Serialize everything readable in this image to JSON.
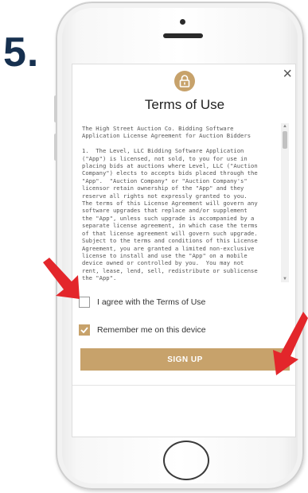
{
  "step_label": "5.",
  "modal": {
    "title": "Terms of Use",
    "close_glyph": "×",
    "lock_icon": "lock-icon",
    "terms_text": "The High Street Auction Co. Bidding Software\nApplication License Agreement for Auction Bidders\n\n1.  The Level, LLC Bidding Software Application\n(\"App\") is licensed, not sold, to you for use in\nplacing bids at auctions where Level, LLC (\"Auction\nCompany\") elects to accepts bids placed through the\n\"App\".  \"Auction Company\" or \"Auction Company's\"\nlicensor retain ownership of the \"App\" and they\nreserve all rights not expressly granted to you.\nThe terms of this License Agreement will govern any\nsoftware upgrades that replace and/or supplement\nthe \"App\", unless such upgrade is accompanied by a\nseparate license agreement, in which case the terms\nof that license agreement will govern such upgrade.\nSubject to the terms and conditions of this License\nAgreement, you are granted a limited non-exclusive\nlicense to install and use the \"App\" on a mobile\ndevice owned or controlled by you.  You may not\nrent, lease, lend, sell, redistribute or sublicense\nthe \"App\".",
    "agree_label": "I agree with the Terms of Use",
    "agree_checked": false,
    "remember_label": "Remember me on this device",
    "remember_checked": true,
    "signup_label": "SIGN UP",
    "accent_color": "#c7a26b"
  },
  "annotations": {
    "arrow_color": "#e3262b"
  }
}
